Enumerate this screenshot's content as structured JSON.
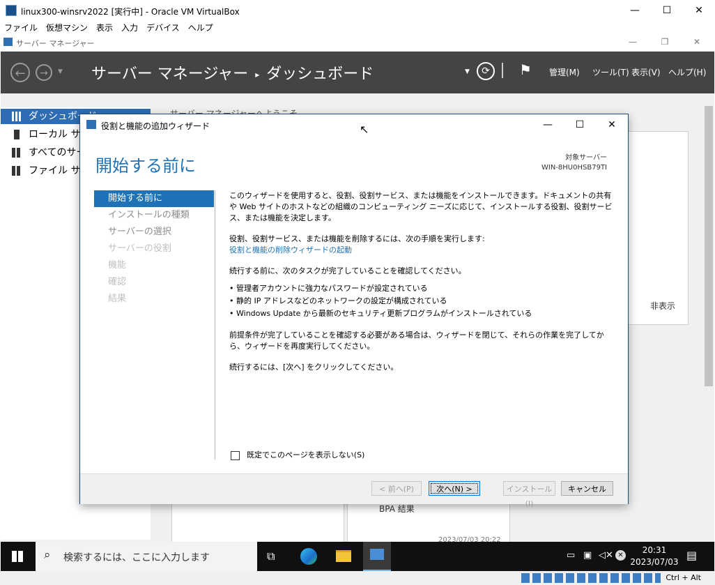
{
  "vbox": {
    "title": "linux300-winsrv2022 [実行中] - Oracle VM VirtualBox",
    "menu": [
      "ファイル",
      "仮想マシン",
      "表示",
      "入力",
      "デバイス",
      "ヘルプ"
    ],
    "hostkey": "Ctrl + Alt"
  },
  "server_manager": {
    "window_title": "サーバー マネージャー",
    "breadcrumb_root": "サーバー マネージャー",
    "breadcrumb_current": "ダッシュボード",
    "menus": [
      "管理(M)",
      "ツール(T)",
      "表示(V)",
      "ヘルプ(H)"
    ],
    "sidebar": [
      {
        "label": "ダッシュボード"
      },
      {
        "label": "ローカル サーバー"
      },
      {
        "label": "すべてのサーバー"
      },
      {
        "label": "ファイル サービス"
      }
    ],
    "welcome": "サーバー マネージャーへようこそ",
    "hide_label": "非表示",
    "bpa_label": "BPA 結果",
    "panel_timestamp": "2023/07/03 20:22"
  },
  "wizard": {
    "title": "役割と機能の追加ウィザード",
    "heading": "開始する前に",
    "target_label": "対象サーバー",
    "target_server": "WIN-8HU0HSB79TI",
    "steps": [
      {
        "label": "開始する前に",
        "state": "active"
      },
      {
        "label": "インストールの種類",
        "state": "normal"
      },
      {
        "label": "サーバーの選択",
        "state": "normal"
      },
      {
        "label": "サーバーの役割",
        "state": "dim"
      },
      {
        "label": "機能",
        "state": "dim"
      },
      {
        "label": "確認",
        "state": "dim"
      },
      {
        "label": "結果",
        "state": "dim"
      }
    ],
    "para1": "このウィザードを使用すると、役割、役割サービス、または機能をインストールできます。ドキュメントの共有や Web サイトのホストなどの組織のコンピューティング ニーズに応じて、インストールする役割、役割サービス、または機能を決定します。",
    "para2": "役割、役割サービス、または機能を削除するには、次の手順を実行します:",
    "remove_link": "役割と機能の削除ウィザードの起動",
    "para3": "続行する前に、次のタスクが完了していることを確認してください。",
    "bullets": [
      "管理者アカウントに強力なパスワードが設定されている",
      "静的 IP アドレスなどのネットワークの設定が構成されている",
      "Windows Update から最新のセキュリティ更新プログラムがインストールされている"
    ],
    "para4": "前提条件が完了していることを確認する必要がある場合は、ウィザードを閉じて、それらの作業を完了してから、ウィザードを再度実行してください。",
    "para5": "続行するには、[次へ] をクリックしてください。",
    "checkbox_label": "既定でこのページを表示しない(S)",
    "buttons": {
      "prev": "< 前へ(P)",
      "next": "次へ(N) >",
      "install": "インストール(I)",
      "cancel": "キャンセル"
    }
  },
  "taskbar": {
    "search_placeholder": "検索するには、ここに入力します",
    "time": "20:31",
    "date": "2023/07/03"
  }
}
